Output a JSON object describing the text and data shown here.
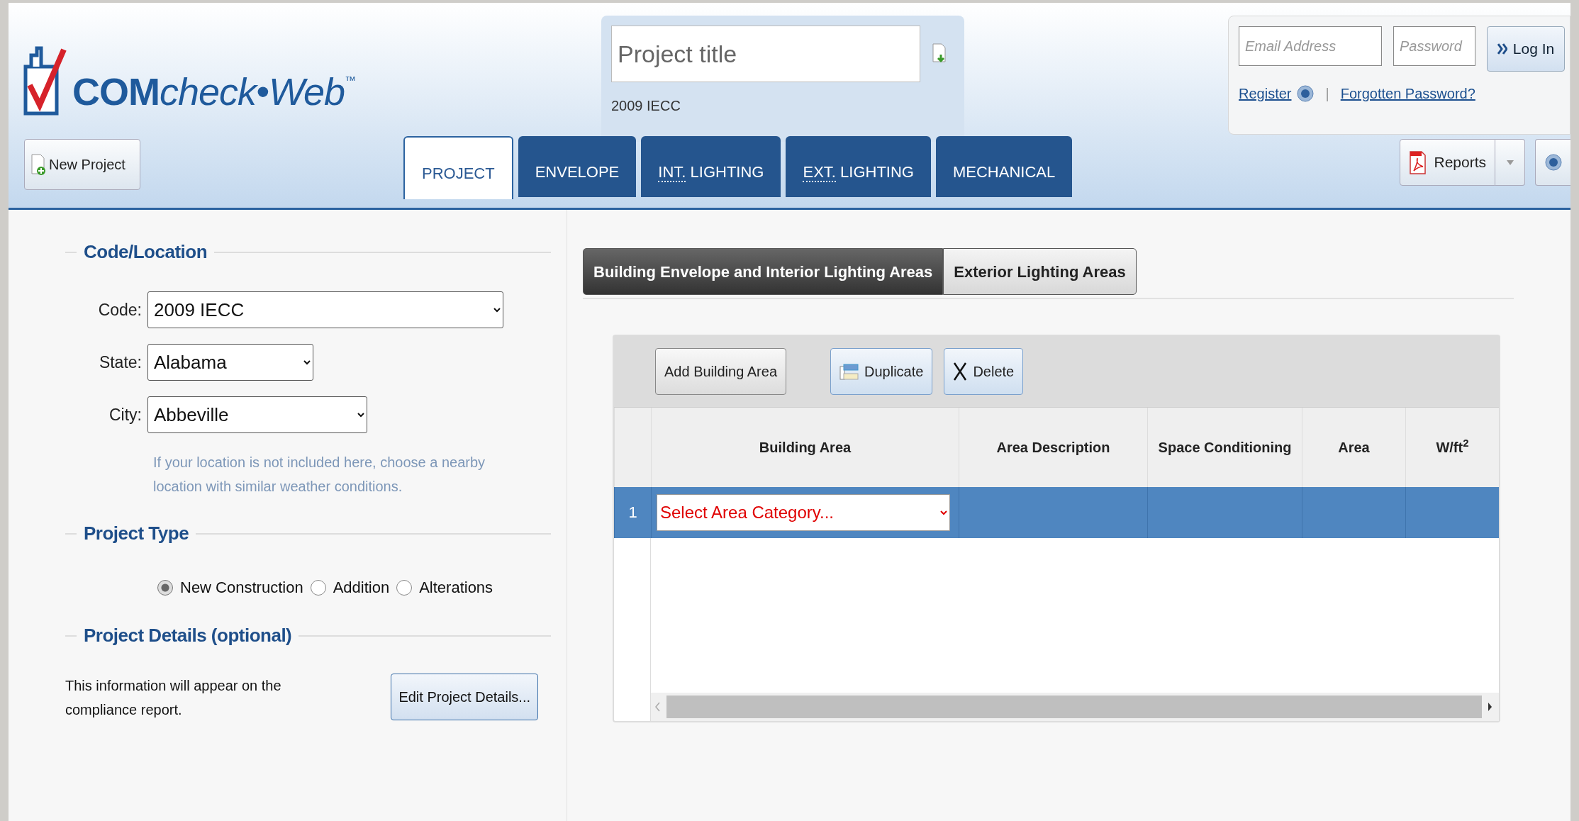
{
  "logo": {
    "bold": "COM",
    "italic": "check•Web",
    "mark": "™"
  },
  "project": {
    "title": {
      "placeholder": "Project title"
    },
    "code": "2009 IECC"
  },
  "login": {
    "email": {
      "placeholder": "Email Address"
    },
    "password": {
      "placeholder": "Password"
    },
    "button": "Log In",
    "links": [
      "Register",
      "Forgotten Password?"
    ],
    "separator": "|"
  },
  "new_project": "New Project",
  "tabs": [
    {
      "label": "PROJECT",
      "selected": true
    },
    {
      "label": "ENVELOPE",
      "selected": false
    },
    {
      "abbr": "INT.",
      "label": "LIGHTING",
      "selected": false
    },
    {
      "abbr": "EXT.",
      "label": "LIGHTING",
      "selected": false
    },
    {
      "label": "MECHANICAL",
      "selected": false
    }
  ],
  "reports": "Reports",
  "code_location": {
    "legend": "Code/Location",
    "fields": [
      {
        "label": "Code:",
        "value": "2009 IECC"
      },
      {
        "label": "State:",
        "value": "Alabama"
      },
      {
        "label": "City:",
        "value": "Abbeville"
      }
    ],
    "hint": "If your location is not included here, choose a nearby location with similar weather conditions."
  },
  "project_type": {
    "legend": "Project Type",
    "options": [
      {
        "label": "New Construction",
        "selected": true
      },
      {
        "label": "Addition",
        "selected": false
      },
      {
        "label": "Alterations",
        "selected": false
      }
    ]
  },
  "project_details": {
    "legend": "Project Details (optional)",
    "text": "This information will appear on the compliance report.",
    "button": "Edit Project Details..."
  },
  "area_tabs": [
    {
      "label": "Building Envelope and Interior Lighting Areas",
      "selected": true
    },
    {
      "label": "Exterior Lighting Areas",
      "selected": false
    }
  ],
  "grid": {
    "toolbar": [
      {
        "label": "Add Building Area",
        "kind": "plain"
      },
      {
        "label": "Duplicate",
        "kind": "copy"
      },
      {
        "label": "Delete",
        "kind": "delete"
      }
    ],
    "columns": [
      "Building Area",
      "Area Description",
      "Space Conditioning",
      "Area",
      "W/ft$^{2}$"
    ],
    "rows": [
      {
        "number": "1",
        "selected": true,
        "building_area": "Select Area Category..."
      }
    ]
  }
}
